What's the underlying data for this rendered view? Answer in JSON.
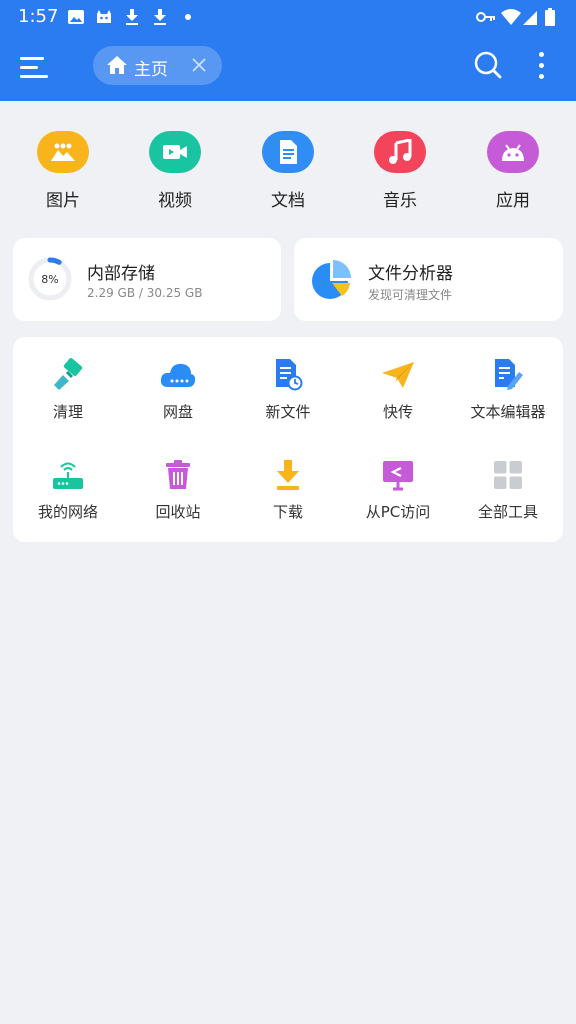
{
  "status_bar": {
    "time": "1:57",
    "icons": [
      "image-icon",
      "android-icon",
      "download-icon",
      "download-icon",
      "dot-icon",
      "vpn-key-icon",
      "wifi-icon",
      "signal-icon",
      "battery-icon"
    ]
  },
  "header": {
    "tab_label": "主页",
    "background_color": "#2a7cf0",
    "icons": [
      "menu-icon",
      "home-icon",
      "close-icon",
      "search-icon",
      "more-vert-icon"
    ]
  },
  "categories": [
    {
      "label": "图片",
      "icon": "image-icon",
      "color": "#f7b41b"
    },
    {
      "label": "视频",
      "icon": "video-icon",
      "color": "#19c5a0"
    },
    {
      "label": "文档",
      "icon": "document-icon",
      "color": "#2f8df3"
    },
    {
      "label": "音乐",
      "icon": "music-icon",
      "color": "#f2445a"
    },
    {
      "label": "应用",
      "icon": "android-icon",
      "color": "#c65bd8"
    }
  ],
  "storage": {
    "title": "内部存储",
    "usage": "2.29 GB / 30.25 GB",
    "percent_label": "8%",
    "percent": 8
  },
  "analyzer": {
    "title": "文件分析器",
    "subtitle": "发现可清理文件"
  },
  "tools": [
    {
      "label": "清理",
      "icon": "broom-icon"
    },
    {
      "label": "网盘",
      "icon": "cloud-icon"
    },
    {
      "label": "新文件",
      "icon": "new-file-icon"
    },
    {
      "label": "快传",
      "icon": "send-icon"
    },
    {
      "label": "文本编辑器",
      "icon": "text-editor-icon"
    },
    {
      "label": "我的网络",
      "icon": "router-icon"
    },
    {
      "label": "回收站",
      "icon": "trash-icon"
    },
    {
      "label": "下载",
      "icon": "download-icon"
    },
    {
      "label": "从PC访问",
      "icon": "pc-access-icon"
    },
    {
      "label": "全部工具",
      "icon": "grid-icon"
    }
  ]
}
